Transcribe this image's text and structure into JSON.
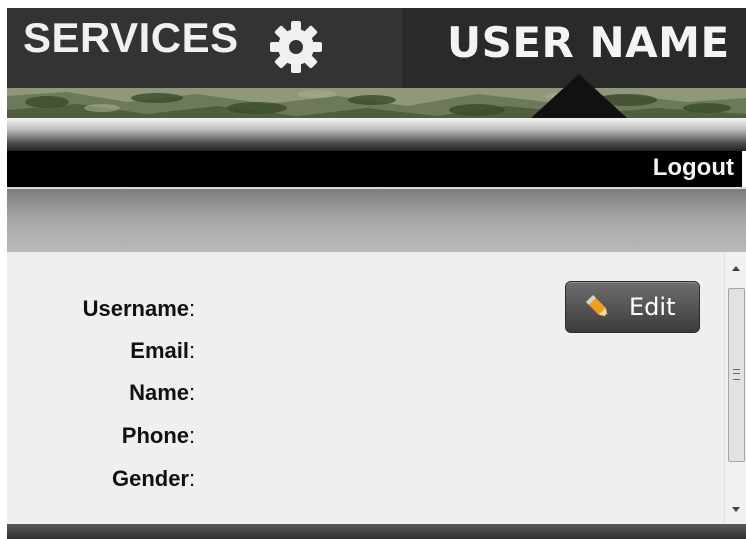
{
  "header": {
    "services_label": "SERVICES",
    "services_icon": "gear-icon",
    "user_label": "USER NAME"
  },
  "toolbar": {
    "logout_label": "Logout"
  },
  "profile": {
    "edit_label": "Edit",
    "edit_icon": "pencil-icon",
    "fields": [
      {
        "label": "Username",
        "sep": ":"
      },
      {
        "label": "Email",
        "sep": ":"
      },
      {
        "label": "Name",
        "sep": ":"
      },
      {
        "label": "Phone",
        "sep": ":"
      },
      {
        "label": "Gender",
        "sep": ":"
      }
    ]
  },
  "colors": {
    "header_bg": "#2a2a2a",
    "toolbar_bg": "#000000",
    "content_bg": "#efefef",
    "button_bg": "#4e4e4e",
    "pencil_orange": "#f0a020"
  }
}
